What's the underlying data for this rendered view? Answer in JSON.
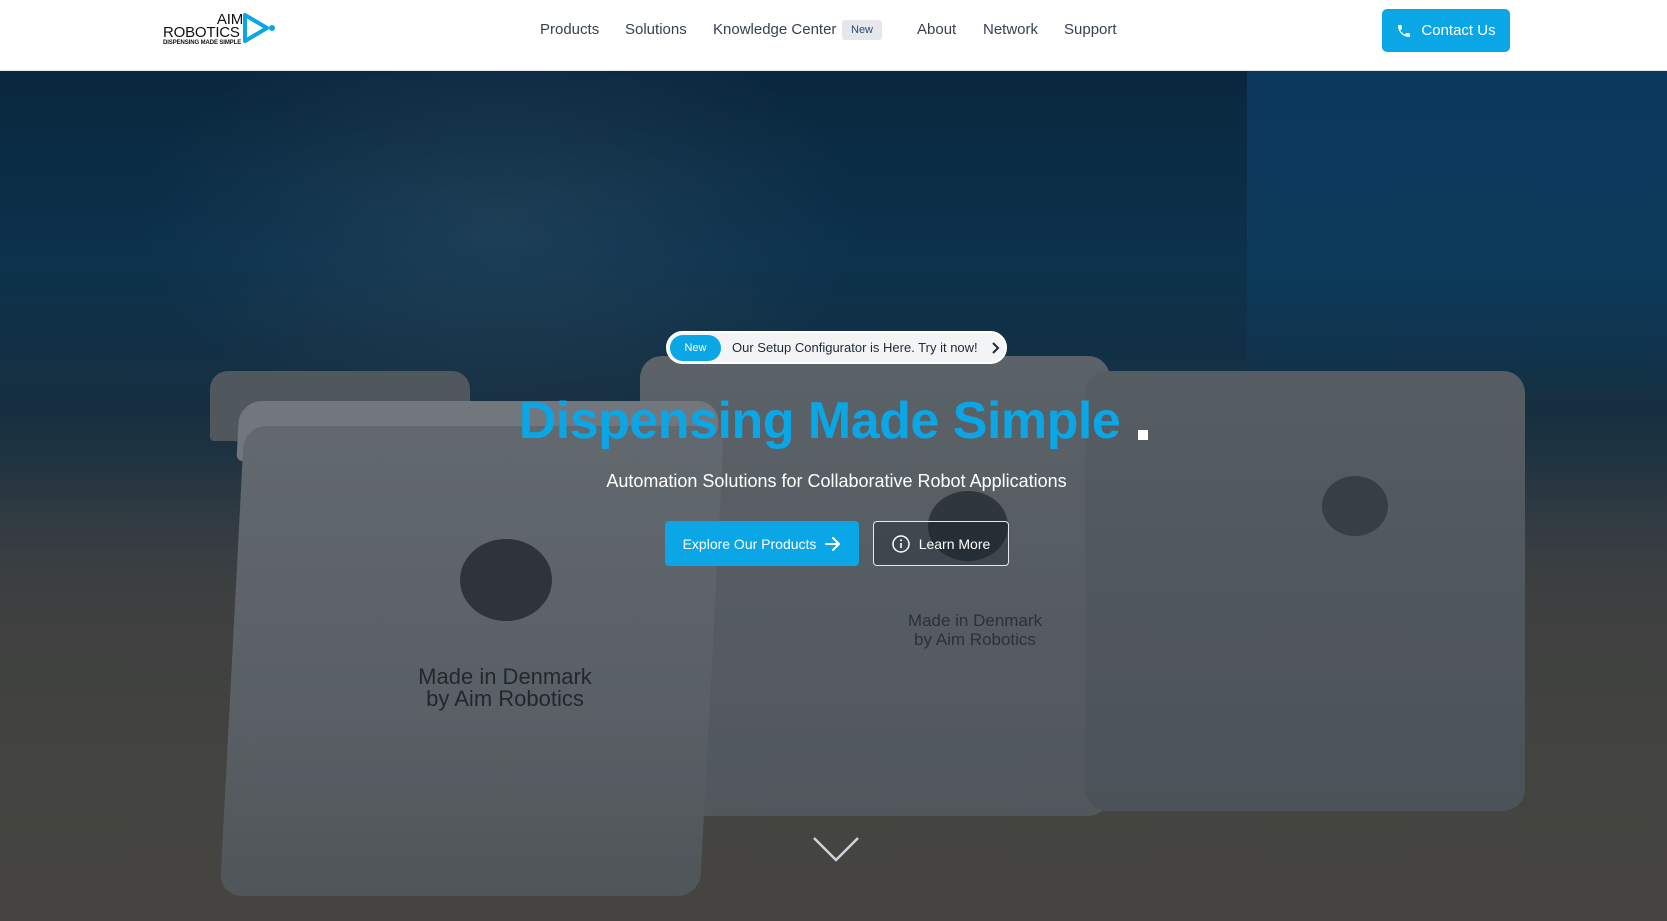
{
  "header": {
    "logo": {
      "line1": "AIM",
      "line2": "ROBOTICS",
      "tagline": "DISPENSING MADE SIMPLE"
    },
    "nav": [
      {
        "label": "Products"
      },
      {
        "label": "Solutions"
      },
      {
        "label": "Knowledge Center",
        "badge": "New"
      },
      {
        "label": "About"
      },
      {
        "label": "Network"
      },
      {
        "label": "Support"
      }
    ],
    "contact_label": "Contact Us"
  },
  "hero": {
    "announcement": {
      "badge": "New",
      "text": "Our Setup Configurator is Here. Try it now!"
    },
    "title": "Dispensing Made Simple",
    "subtitle": "Automation Solutions for Collaborative Robot Applications",
    "primary_cta": "Explore Our Products",
    "secondary_cta": "Learn More",
    "background_stamp_large": [
      "Made in Denmark",
      "by Aim Robotics"
    ],
    "background_stamp_medium": [
      "Made in Denmark",
      "by Aim Robotics"
    ],
    "background_stamp_small": [
      "",
      ""
    ]
  },
  "colors": {
    "accent": "#0aa6e6",
    "header_bg": "#ffffff",
    "nav_text": "#374151"
  },
  "icons": [
    "logo-play-icon",
    "phone-icon",
    "chevron-right-icon",
    "arrow-right-icon",
    "info-icon",
    "chevron-down-icon"
  ]
}
